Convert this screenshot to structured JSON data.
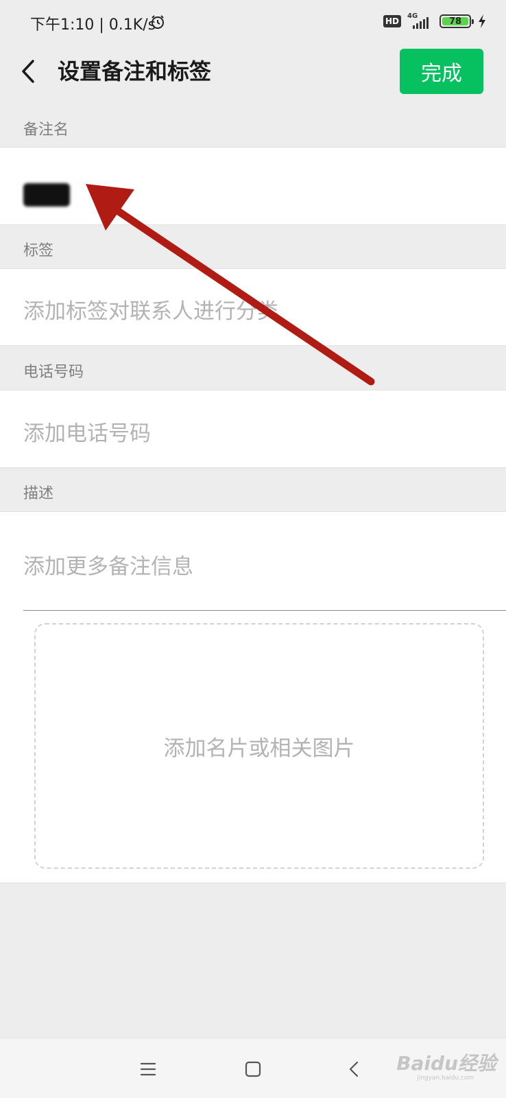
{
  "status_bar": {
    "time_speed": "下午1:10 | 0.1K/s",
    "hd_badge": "HD",
    "network": "4G",
    "battery_level": "78"
  },
  "navbar": {
    "title": "设置备注和标签",
    "done_label": "完成"
  },
  "sections": {
    "remark_label": "备注名",
    "tags_label": "标签",
    "tags_placeholder": "添加标签对联系人进行分类",
    "phone_label": "电话号码",
    "phone_placeholder": "添加电话号码",
    "desc_label": "描述",
    "desc_placeholder": "添加更多备注信息",
    "card_placeholder": "添加名片或相关图片"
  },
  "annotation": {
    "color": "#b01c14"
  },
  "watermark": {
    "brand": "Baidu经验",
    "url": "jingyan.baidu.com"
  },
  "colors": {
    "accent": "#07c160",
    "background": "#ededed"
  }
}
